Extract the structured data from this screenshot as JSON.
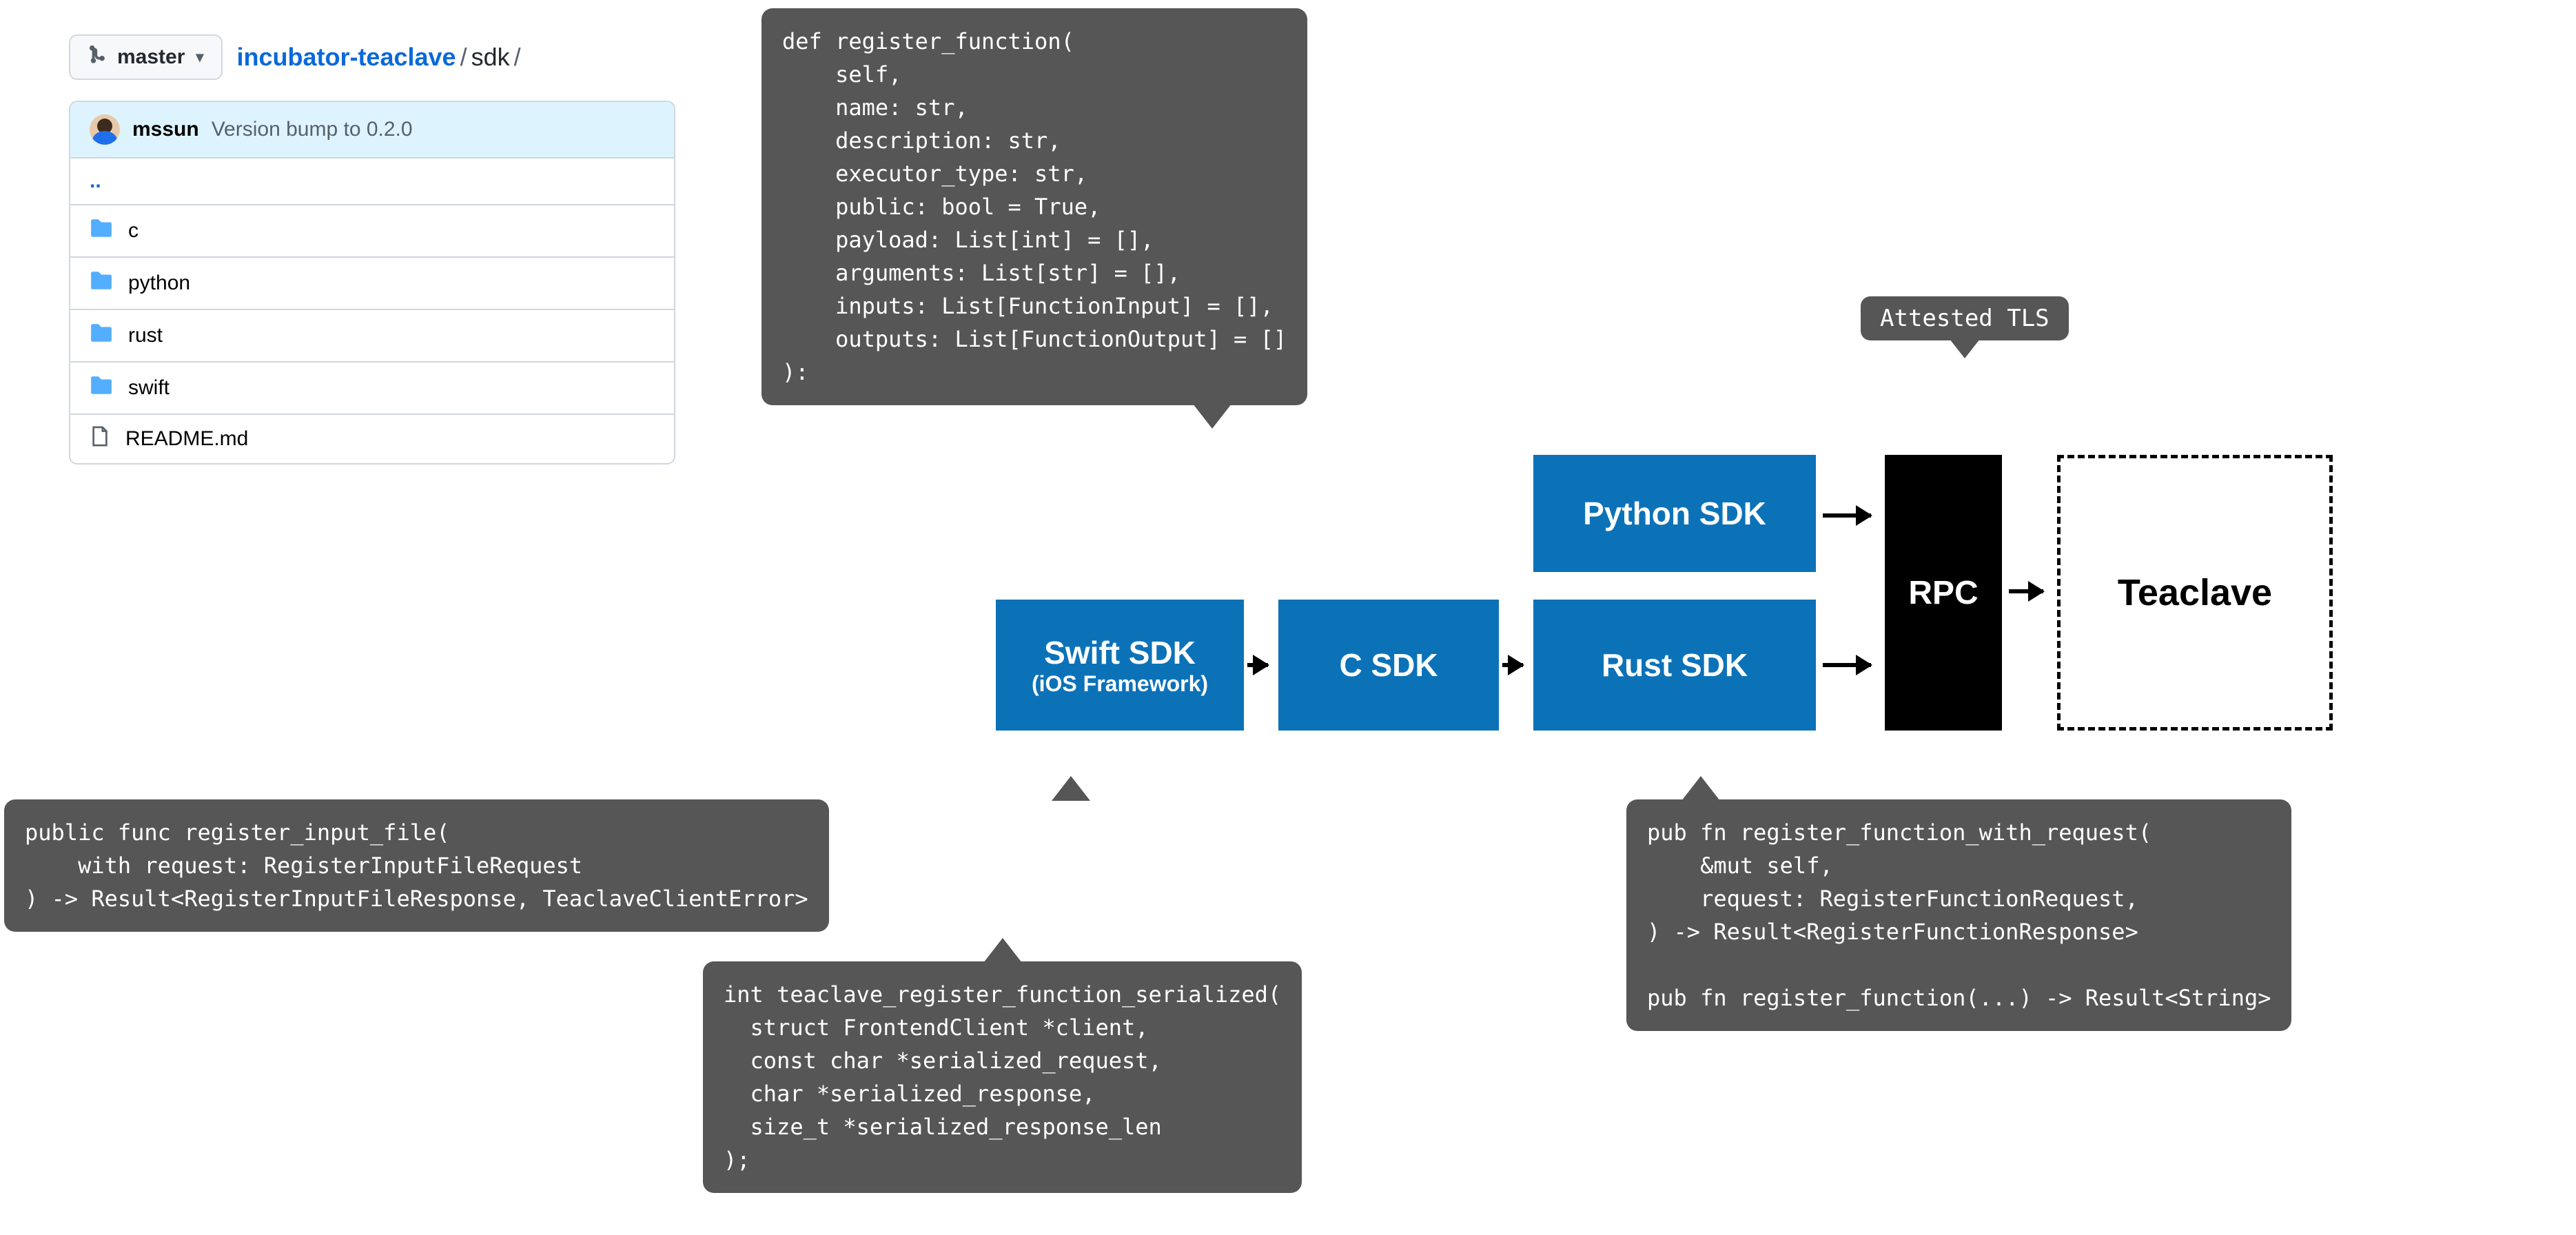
{
  "github": {
    "branch": "master",
    "repo": "incubator-teaclave",
    "path": "sdk",
    "commit": {
      "author": "mssun",
      "message": "Version bump to 0.2.0"
    },
    "parent": "..",
    "rows": [
      {
        "type": "folder",
        "name": "c"
      },
      {
        "type": "folder",
        "name": "python"
      },
      {
        "type": "folder",
        "name": "rust"
      },
      {
        "type": "folder",
        "name": "swift"
      },
      {
        "type": "file",
        "name": "README.md"
      }
    ]
  },
  "code": {
    "python": "def register_function(\n    self,\n    name: str,\n    description: str,\n    executor_type: str,\n    public: bool = True,\n    payload: List[int] = [],\n    arguments: List[str] = [],\n    inputs: List[FunctionInput] = [],\n    outputs: List[FunctionOutput] = []\n):",
    "swift": "public func register_input_file(\n    with request: RegisterInputFileRequest\n) -> Result<RegisterInputFileResponse, TeaclaveClientError>",
    "c": "int teaclave_register_function_serialized(\n  struct FrontendClient *client,\n  const char *serialized_request,\n  char *serialized_response,\n  size_t *serialized_response_len\n);",
    "rust": "pub fn register_function_with_request(\n    &mut self,\n    request: RegisterFunctionRequest,\n) -> Result<RegisterFunctionResponse>\n\npub fn register_function(...) -> Result<String>"
  },
  "labels": {
    "attested": "Attested TLS",
    "swift_sdk": "Swift SDK",
    "swift_sub": "(iOS Framework)",
    "c_sdk": "C SDK",
    "python_sdk": "Python SDK",
    "rust_sdk": "Rust SDK",
    "rpc": "RPC",
    "teaclave": "Teaclave"
  }
}
